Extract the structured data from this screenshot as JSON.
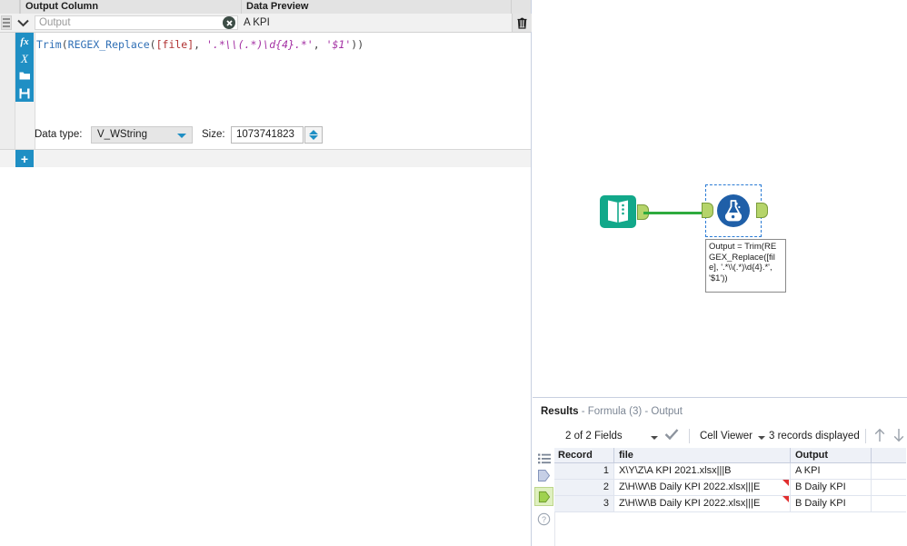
{
  "config_panel": {
    "headers": {
      "output_column": "Output Column",
      "data_preview": "Data Preview"
    },
    "output_name": "Output",
    "data_preview_value": "A KPI",
    "icons": {
      "drag_handle": "drag-handle-icon",
      "chevron": "chevron-down-icon",
      "clear": "clear-x-icon",
      "trash": "trash-icon",
      "fx": "fx",
      "variable": "X",
      "open": "folder-open-icon",
      "save": "floppy-save-icon",
      "add": "plus-icon"
    },
    "formula": {
      "full_text": "Trim(REGEX_Replace([file], '.*\\\\(.*)\\d{4}.*', '$1'))",
      "tokens": [
        {
          "t": "Trim",
          "k": "fn"
        },
        {
          "t": "(",
          "k": "punc"
        },
        {
          "t": "REGEX_Replace",
          "k": "fn"
        },
        {
          "t": "(",
          "k": "punc"
        },
        {
          "t": "[file]",
          "k": "field"
        },
        {
          "t": ", ",
          "k": "punc"
        },
        {
          "t": "'.*\\\\(.*)\\d{4}.*'",
          "k": "str"
        },
        {
          "t": ", ",
          "k": "punc"
        },
        {
          "t": "'$1'",
          "k": "str"
        },
        {
          "t": "))",
          "k": "punc"
        }
      ]
    },
    "data_type_label": "Data type:",
    "data_type_value": "V_WString",
    "size_label": "Size:",
    "size_value": "1073741823"
  },
  "canvas": {
    "input_node_name": "text-input-tool",
    "formula_node_name": "formula-tool",
    "annotation": "Output = Trim(REGEX_Replace([file], '.*\\\\(.*)\\d{4}.*', '$1'))"
  },
  "results": {
    "title_label": "Results",
    "title_suffix": " - Formula (3) - Output",
    "toolbar": {
      "fields": "2 of 2 Fields",
      "check": "check-icon",
      "cell_viewer": "Cell Viewer",
      "records": "3 records displayed",
      "up": "arrow-up-icon",
      "down": "arrow-down-icon"
    },
    "rail_icons": [
      "list-config-icon",
      "input-anchor-icon",
      "output-anchor-icon",
      "help-icon"
    ],
    "table": {
      "columns": [
        "Record",
        "file",
        "Output"
      ],
      "rows": [
        {
          "record": "1",
          "file": "X\\Y\\Z\\A KPI 2021.xlsx|||B",
          "output": "A KPI",
          "warn": false
        },
        {
          "record": "2",
          "file": "Z\\H\\W\\B Daily KPI 2022.xlsx|||E",
          "output": "B Daily KPI",
          "warn": true
        },
        {
          "record": "3",
          "file": "Z\\H\\W\\B Daily KPI 2022.xlsx|||E",
          "output": "B Daily KPI",
          "warn": true
        }
      ]
    },
    "colors": {
      "quality_bad": "#e03030",
      "quality_good": "#8fe06a"
    }
  }
}
